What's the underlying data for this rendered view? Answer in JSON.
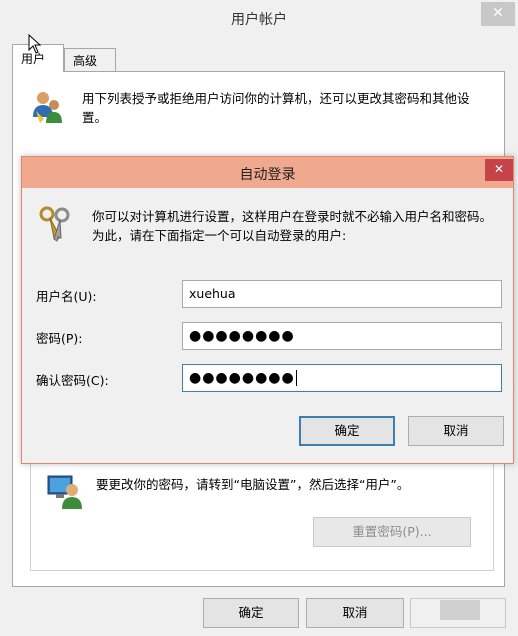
{
  "outer_window": {
    "title": "用户帐户",
    "close_glyph": "✕",
    "tabs": [
      {
        "label": "用户"
      },
      {
        "label": "高级"
      }
    ],
    "description": "用下列表授予或拒绝用户访问你的计算机，还可以更改其密码和其他设置。",
    "password_note": "要更改你的密码，请转到“电脑设置”，然后选择“用户”。",
    "reset_password_label": "重置密码(P)...",
    "ok_label": "确定",
    "cancel_label": "取消"
  },
  "dialog": {
    "title": "自动登录",
    "close_glyph": "✕",
    "description": "你可以对计算机进行设置，这样用户在登录时就不必输入用户名和密码。为此，请在下面指定一个可以自动登录的用户:",
    "username_label": "用户名(U):",
    "username_value": "xuehua",
    "password_label": "密码(P):",
    "password_value": "●●●●●●●●",
    "confirm_label": "确认密码(C):",
    "confirm_value": "●●●●●●●●",
    "ok_label": "确定",
    "cancel_label": "取消"
  },
  "colors": {
    "dialog_title_bg": "#f0a88e",
    "dialog_close_bg": "#c7434a",
    "focus_border": "#3c7fb1"
  },
  "icons": [
    "users-icon",
    "keys-icon",
    "user-pc-icon",
    "close-icon",
    "cursor-icon"
  ]
}
